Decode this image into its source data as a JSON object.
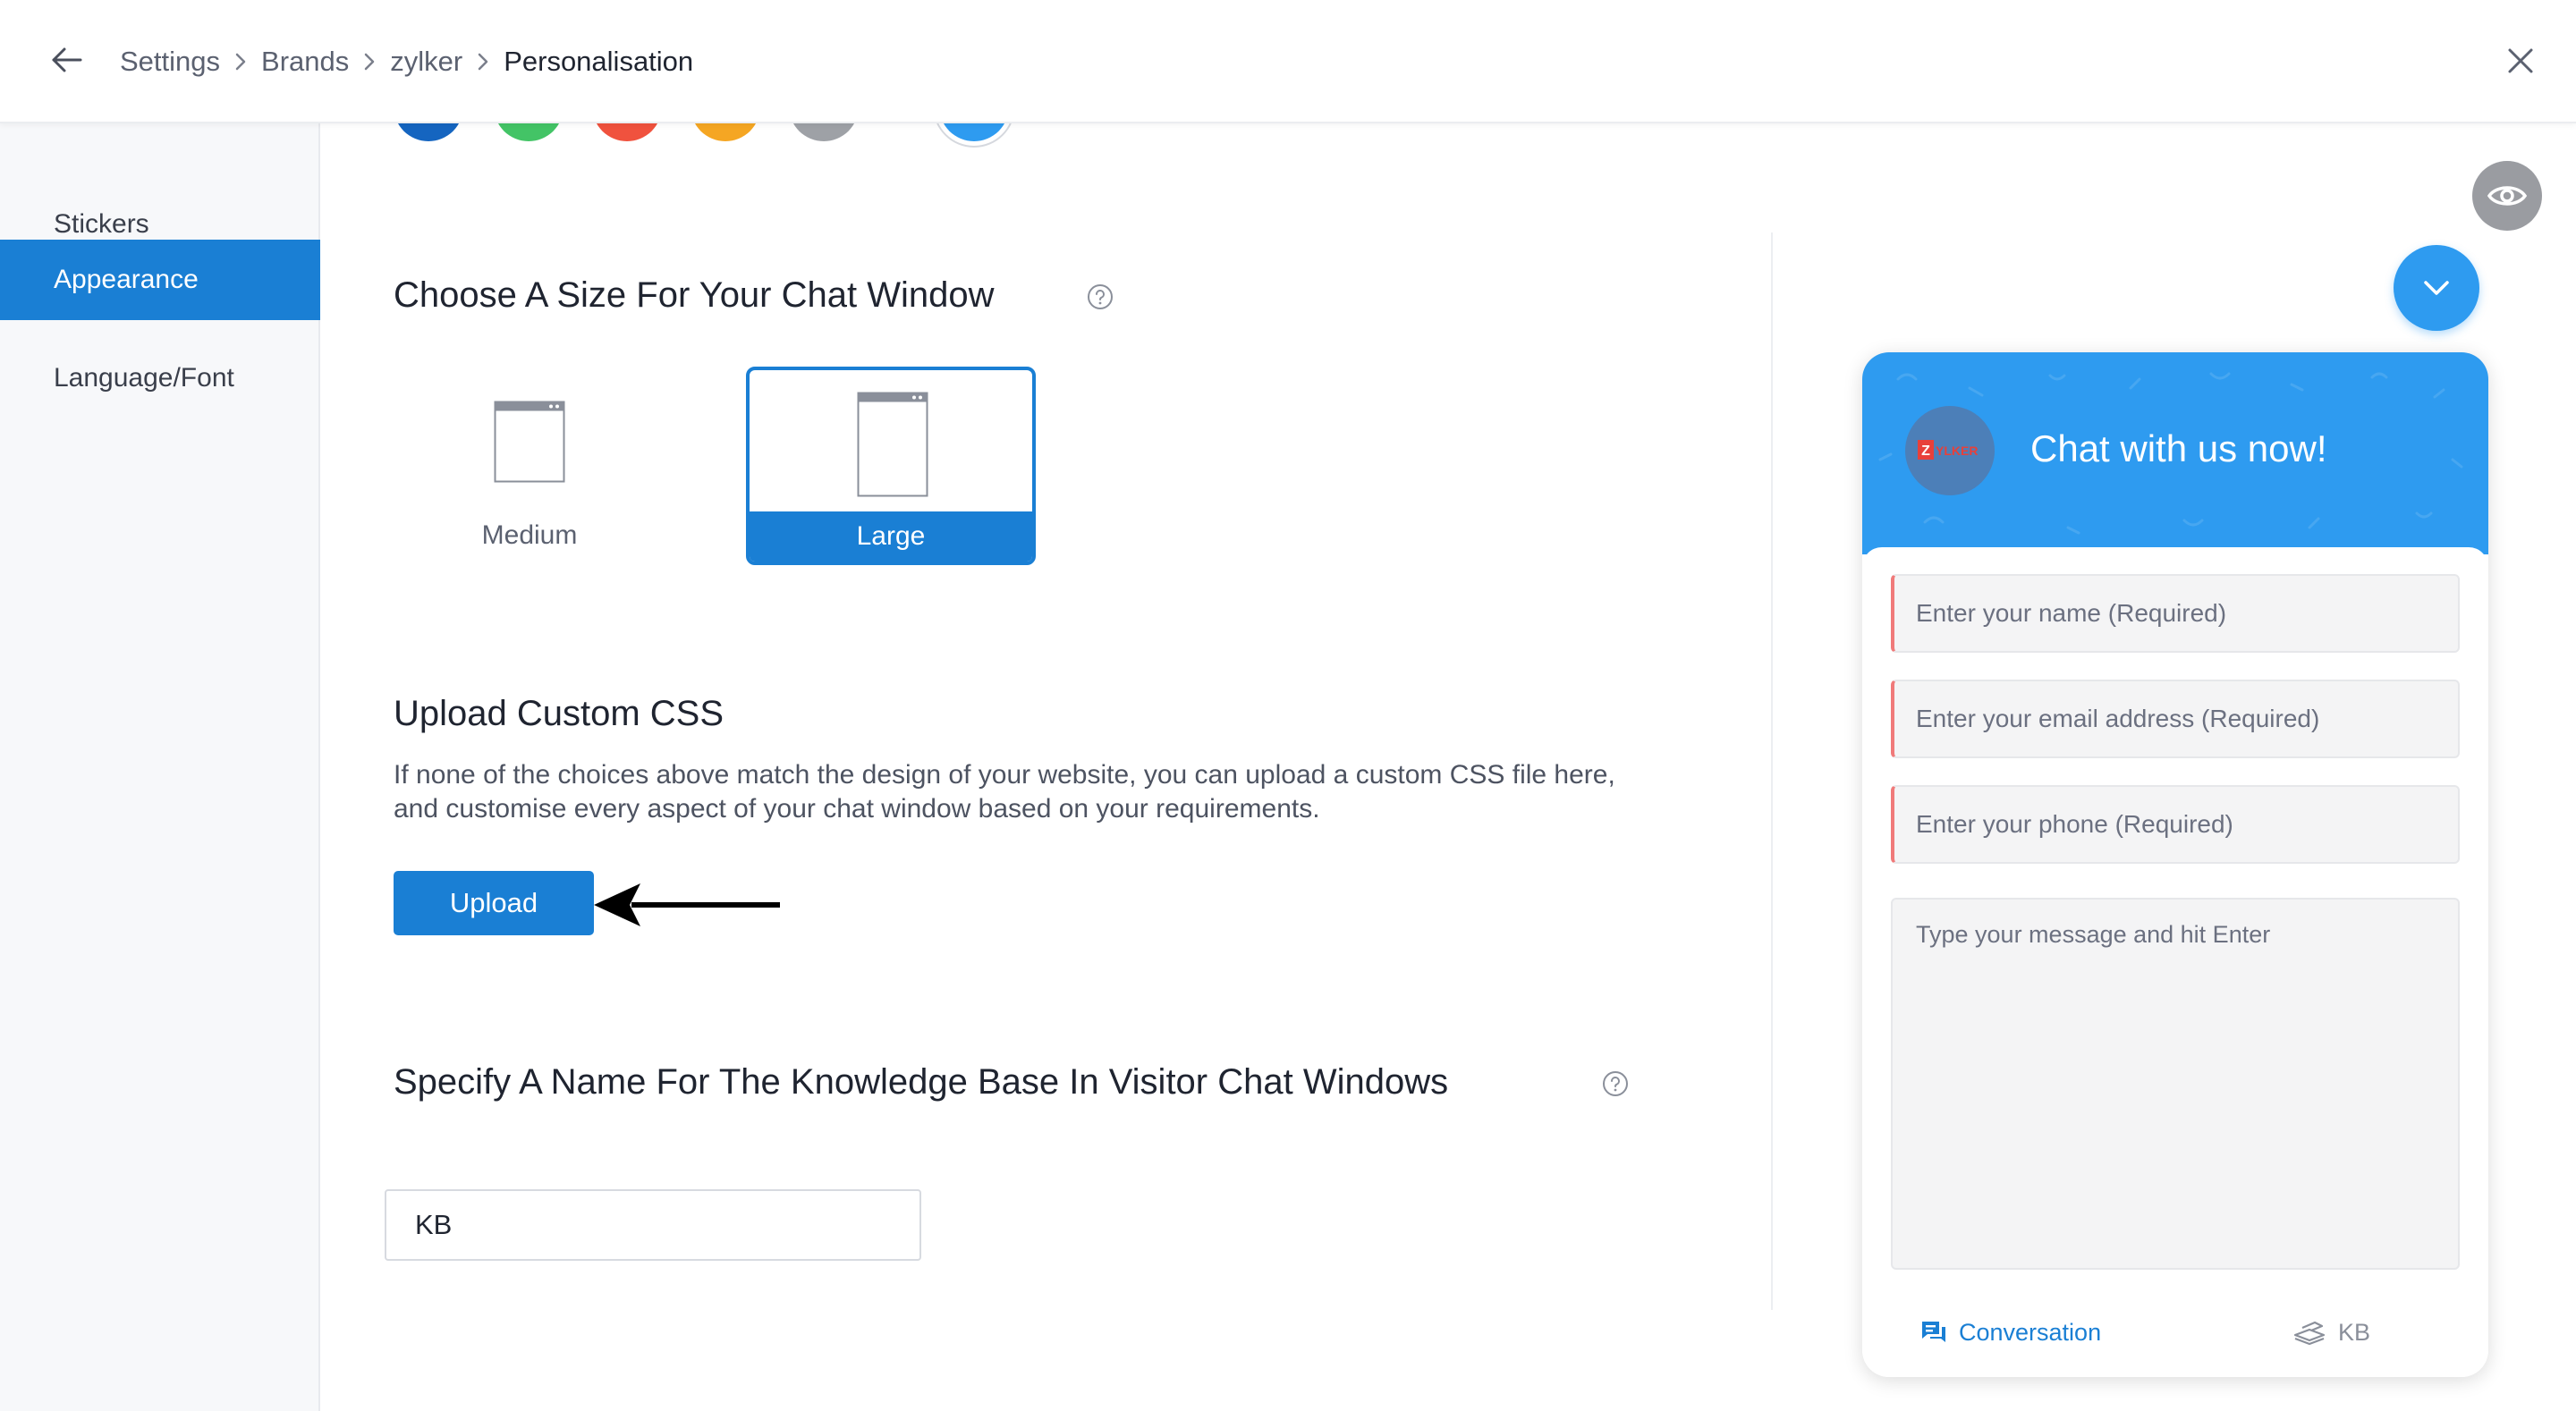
{
  "breadcrumb": [
    {
      "label": "Settings"
    },
    {
      "label": "Brands"
    },
    {
      "label": "zylker"
    },
    {
      "label": "Personalisation",
      "current": true
    }
  ],
  "sidebar": {
    "items": [
      {
        "label": "Stickers",
        "active": false
      },
      {
        "label": "Appearance",
        "active": true
      },
      {
        "label": "Language/Font",
        "active": false
      }
    ]
  },
  "theme_colors": [
    "#1565c0",
    "#43c466",
    "#f0523e",
    "#f5a623",
    "#9ea1a6",
    "#2e9bf0"
  ],
  "size_section": {
    "title": "Choose A Size For Your Chat Window",
    "options": [
      {
        "label": "Medium",
        "selected": false
      },
      {
        "label": "Large",
        "selected": true
      }
    ]
  },
  "css_section": {
    "title": "Upload Custom CSS",
    "description_line1": "If none of the choices above match the design of your website, you can upload a custom CSS file here,",
    "description_line2": "and customise every aspect of your chat window based on your requirements.",
    "upload_label": "Upload"
  },
  "kb_section": {
    "title": "Specify A Name For The Knowledge Base In Visitor Chat Windows",
    "value": "KB"
  },
  "preview": {
    "header_title": "Chat with us now!",
    "logo_text": "ZYLKER",
    "fields": [
      {
        "placeholder": "Enter your name  (Required)"
      },
      {
        "placeholder": "Enter your email address (Required)"
      },
      {
        "placeholder": "Enter your phone (Required)"
      }
    ],
    "message_placeholder": "Type your message and hit Enter",
    "tabs": [
      {
        "label": "Conversation",
        "active": true
      },
      {
        "label": "KB",
        "active": false
      }
    ]
  },
  "colors": {
    "accent": "#1a7fd4",
    "chat_brand": "#2e9bf0",
    "required_marker": "#f07a7a"
  }
}
